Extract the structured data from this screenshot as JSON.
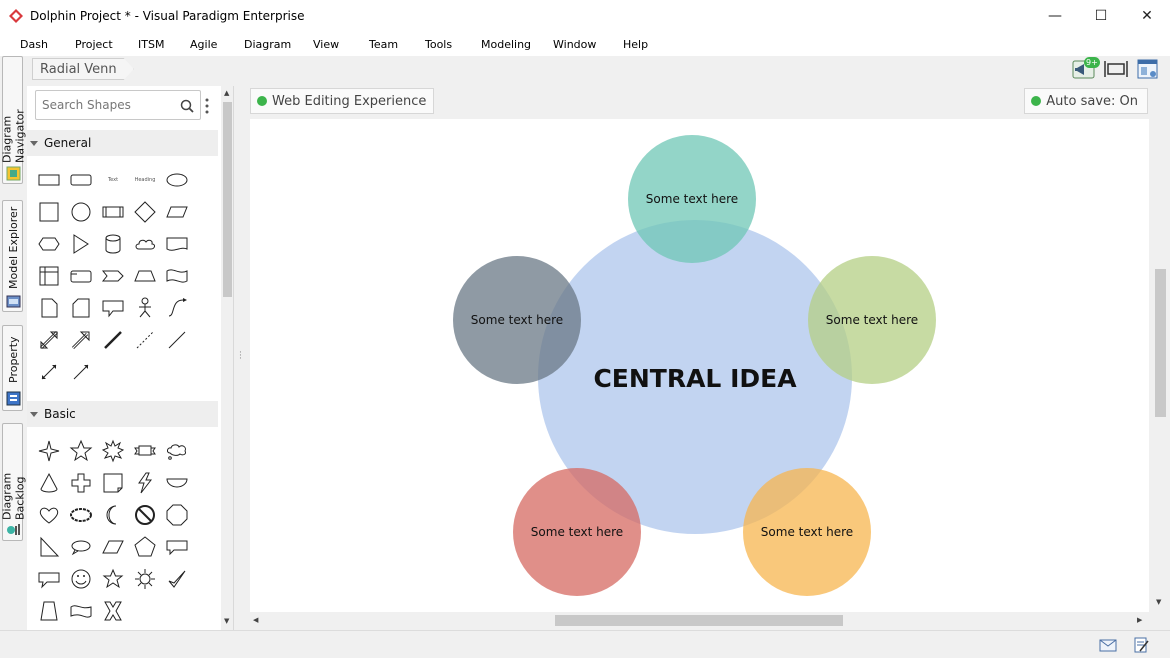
{
  "window": {
    "title": "Dolphin Project * - Visual Paradigm Enterprise",
    "minimize": "—",
    "maximize": "☐",
    "close": "✕"
  },
  "menu": [
    "Dash",
    "Project",
    "ITSM",
    "Agile",
    "Diagram",
    "View",
    "Team",
    "Tools",
    "Modeling",
    "Window",
    "Help"
  ],
  "side_tabs": [
    "Diagram Navigator",
    "Model Explorer",
    "Property",
    "Diagram Backlog"
  ],
  "breadcrumb": "Radial Venn",
  "toolbar": {
    "notification_badge": "9+"
  },
  "shape_panel": {
    "search_placeholder": "Search Shapes",
    "categories": [
      "General",
      "Basic"
    ],
    "general_text_shape": "Text",
    "general_heading_shape": "Heading"
  },
  "canvas": {
    "web_editing": "Web Editing Experience",
    "auto_save": "Auto save: On"
  },
  "diagram": {
    "central_text": "CENTRAL IDEA",
    "central_color": "#aec6ec",
    "satellites": [
      {
        "text": "Some text here",
        "color": "#6fc7b6"
      },
      {
        "text": "Some text here",
        "color": "#b4cf84"
      },
      {
        "text": "Some text here",
        "color": "#f7b64f"
      },
      {
        "text": "Some text here",
        "color": "#d66a62"
      },
      {
        "text": "Some text here",
        "color": "#6a7885"
      }
    ]
  },
  "colors": {
    "accent_green": "#3cb44b",
    "app_red": "#d9393d"
  }
}
